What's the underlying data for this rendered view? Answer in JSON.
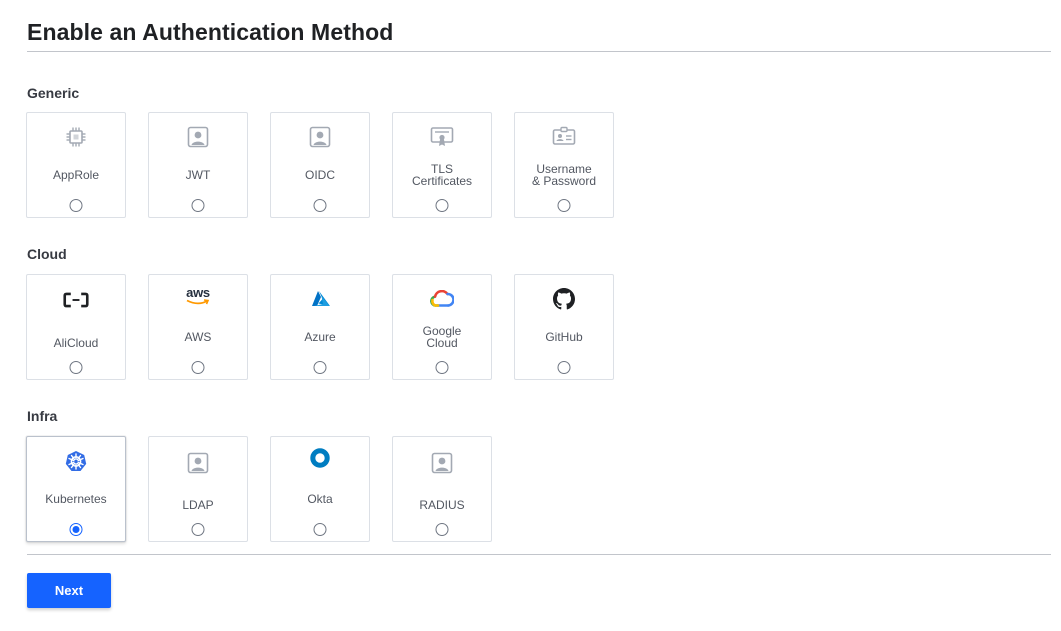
{
  "page": {
    "title": "Enable an Authentication Method",
    "next_label": "Next"
  },
  "sections": {
    "generic": {
      "title": "Generic",
      "items": [
        {
          "label": "AppRole",
          "icon": "chip-icon"
        },
        {
          "label": "JWT",
          "icon": "user-square-icon"
        },
        {
          "label": "OIDC",
          "icon": "user-square-icon"
        },
        {
          "label_line1": "TLS",
          "label_line2": "Certificates",
          "icon": "certificate-icon"
        },
        {
          "label_line1": "Username",
          "label_line2": "& Password",
          "icon": "id-card-icon"
        }
      ]
    },
    "cloud": {
      "title": "Cloud",
      "items": [
        {
          "label": "AliCloud",
          "icon": "alicloud-icon"
        },
        {
          "label": "AWS",
          "icon": "aws-icon",
          "icon_text": "aws"
        },
        {
          "label": "Azure",
          "icon": "azure-icon"
        },
        {
          "label_line1": "Google",
          "label_line2": "Cloud",
          "icon": "google-cloud-icon"
        },
        {
          "label": "GitHub",
          "icon": "github-icon"
        }
      ]
    },
    "infra": {
      "title": "Infra",
      "items": [
        {
          "label": "Kubernetes",
          "icon": "kubernetes-icon",
          "selected": true
        },
        {
          "label": "LDAP",
          "icon": "user-square-icon"
        },
        {
          "label": "Okta",
          "icon": "okta-icon"
        },
        {
          "label": "RADIUS",
          "icon": "user-square-icon"
        }
      ]
    }
  },
  "colors": {
    "primary": "#1563ff",
    "icon_gray": "#a3a9b3",
    "okta_blue": "#007dc1",
    "kubernetes_blue": "#326ce5",
    "azure_blue": "#0089d6",
    "aws_orange": "#ff9900"
  },
  "selected_method": "Kubernetes"
}
